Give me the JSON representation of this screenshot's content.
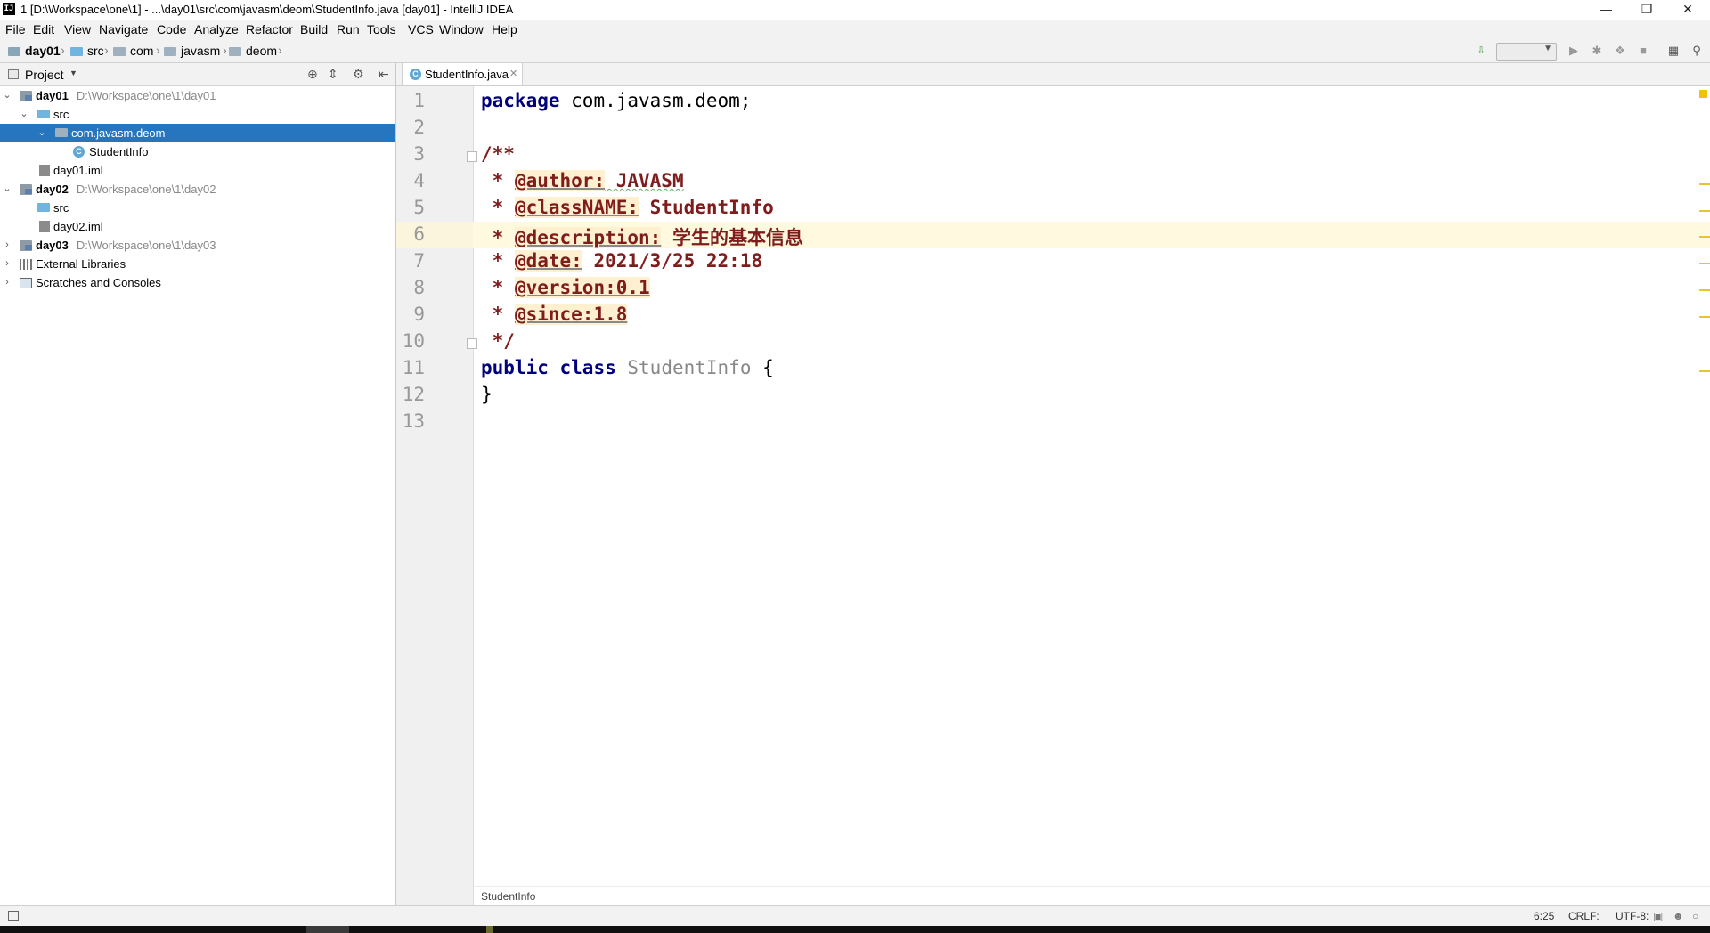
{
  "window": {
    "title": "1 [D:\\Workspace\\one\\1] - ...\\day01\\src\\com\\javasm\\deom\\StudentInfo.java [day01] - IntelliJ IDEA",
    "app_icon": "IJ",
    "minimize_icon": "minimize-icon",
    "restore_icon": "restore-icon",
    "close_icon": "close-icon"
  },
  "menu": [
    "File",
    "Edit",
    "View",
    "Navigate",
    "Code",
    "Analyze",
    "Refactor",
    "Build",
    "Run",
    "Tools",
    "VCS",
    "Window",
    "Help"
  ],
  "navbar": {
    "crumbs": [
      "day01",
      "src",
      "com",
      "javasm",
      "deom"
    ]
  },
  "project_panel": {
    "title": "Project",
    "tree": [
      {
        "label": "day01",
        "path": "D:\\Workspace\\one\\1\\day01",
        "level": 0,
        "expanded": true,
        "icon": "module-icon",
        "bold": true
      },
      {
        "label": "src",
        "level": 1,
        "expanded": true,
        "icon": "source-folder-icon"
      },
      {
        "label": "com.javasm.deom",
        "level": 2,
        "expanded": true,
        "icon": "package-icon",
        "selected": true
      },
      {
        "label": "StudentInfo",
        "level": 3,
        "icon": "class-icon"
      },
      {
        "label": "day01.iml",
        "level": 1,
        "icon": "iml-file-icon"
      },
      {
        "label": "day02",
        "path": "D:\\Workspace\\one\\1\\day02",
        "level": 0,
        "expanded": true,
        "icon": "module-icon",
        "bold": true
      },
      {
        "label": "src",
        "level": 1,
        "icon": "source-folder-icon"
      },
      {
        "label": "day02.iml",
        "level": 1,
        "icon": "iml-file-icon"
      },
      {
        "label": "day03",
        "path": "D:\\Workspace\\one\\1\\day03",
        "level": 0,
        "expanded": false,
        "icon": "module-icon",
        "bold": true
      },
      {
        "label": "External Libraries",
        "level": 0,
        "expanded": false,
        "icon": "libraries-icon"
      },
      {
        "label": "Scratches and Consoles",
        "level": 0,
        "expanded": false,
        "icon": "scratches-icon"
      }
    ]
  },
  "editor": {
    "tab_label": "StudentInfo.java",
    "line_numbers": [
      "1",
      "2",
      "3",
      "4",
      "5",
      "6",
      "7",
      "8",
      "9",
      "10",
      "11",
      "12",
      "13"
    ],
    "code": {
      "l1_kw": "package",
      "l1_rest": " com.javasm.deom;",
      "l3": "/**",
      "star": " * ",
      "l4_tag": "@author:",
      "l4_val": " JAVASM",
      "l5_tag": "@classNAME:",
      "l5_val": " StudentInfo",
      "l6_tag": "@description:",
      "l6_val": " 学生的基本信息",
      "l7_tag": "@date:",
      "l7_val": " 2021/3/25 22:18",
      "l8_tag": "@version:0.1",
      "l9_tag": "@since:1.8",
      "l10": " */",
      "l11_kw1": "public",
      "l11_kw2": "class",
      "l11_name": "StudentInfo",
      "l11_brace": " {",
      "l12": "}"
    },
    "breadcrumb": "StudentInfo",
    "current_line": 6
  },
  "status": {
    "position": "6:25",
    "line_separator": "CRLF:",
    "encoding": "UTF-8:"
  },
  "colors": {
    "selection": "#2675bf",
    "keyword": "#00007f",
    "doc_tag": "#7f1d1d",
    "current_line": "#fff9e0"
  }
}
